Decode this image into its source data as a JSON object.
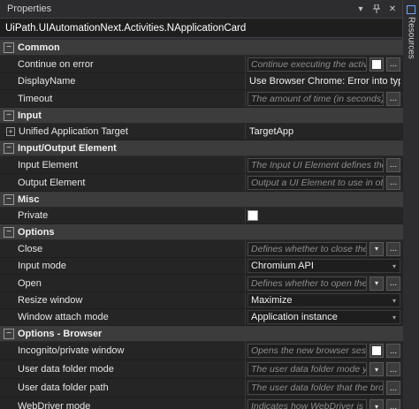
{
  "panel": {
    "title": "Properties",
    "type_name": "UiPath.UIAutomationNext.Activities.NApplicationCard"
  },
  "sidebar": {
    "tab_label": "Resources"
  },
  "categories": {
    "common": "Common",
    "input": "Input",
    "input_output": "Input/Output Element",
    "misc": "Misc",
    "options": "Options",
    "options_browser": "Options - Browser"
  },
  "rows": {
    "continue_on_error": {
      "label": "Continue on error",
      "placeholder": "Continue executing the activities"
    },
    "display_name": {
      "label": "DisplayName",
      "value": "Use Browser Chrome: Error into type into"
    },
    "timeout": {
      "label": "Timeout",
      "placeholder": "The amount of time (in seconds) to w"
    },
    "unified_target": {
      "label": "Unified Application Target",
      "value": "TargetApp"
    },
    "input_element": {
      "label": "Input Element",
      "placeholder": "The Input UI Element defines the scr"
    },
    "output_element": {
      "label": "Output Element",
      "placeholder": "Output a UI Element to use in other"
    },
    "private": {
      "label": "Private"
    },
    "close": {
      "label": "Close",
      "placeholder": "Defines whether to close the targ"
    },
    "input_mode": {
      "label": "Input mode",
      "value": "Chromium API"
    },
    "open": {
      "label": "Open",
      "placeholder": "Defines whether to open the targ"
    },
    "resize_window": {
      "label": "Resize window",
      "value": "Maximize"
    },
    "window_attach_mode": {
      "label": "Window attach mode",
      "value": "Application instance"
    },
    "incognito": {
      "label": "Incognito/private window",
      "placeholder": "Opens the new browser session i"
    },
    "user_data_folder_mode": {
      "label": "User data folder mode",
      "placeholder": "The user data folder mode you w"
    },
    "user_data_folder_path": {
      "label": "User data folder path",
      "placeholder": "The user data folder that the browse"
    },
    "webdriver_mode": {
      "label": "WebDriver mode",
      "placeholder": "Indicates how WebDriver is used"
    }
  },
  "glyphs": {
    "ellipsis": "...",
    "collapse": "−",
    "expand": "+",
    "dropdown": "▾",
    "pin": "▾",
    "close": "✕"
  }
}
